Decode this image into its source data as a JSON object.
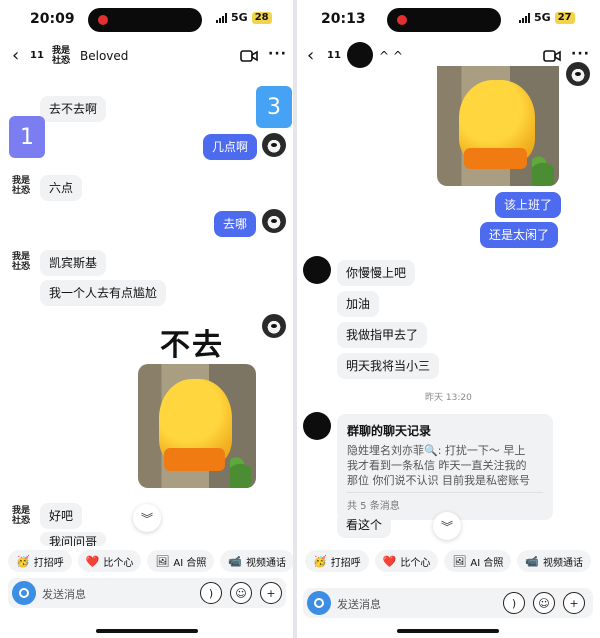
{
  "left": {
    "status": {
      "time": "20:09",
      "network": "5G",
      "battery": "28"
    },
    "header": {
      "back": "‹",
      "unread": "11",
      "nickname": "我是社恐",
      "title": "Beloved",
      "more": "···"
    },
    "messages": {
      "m1": "去不去啊",
      "m2": "几点啊",
      "m3": "六点",
      "m4": "去哪",
      "m5": "凯宾斯基",
      "m6": "我一个人去有点尴尬",
      "m7": "好吧",
      "m8": "我问问哥"
    },
    "nicks": {
      "n1": "我是社恐",
      "n2": "我是社恐",
      "n3": "我是社恐"
    },
    "tiles": {
      "t1": "1",
      "t3": "3"
    },
    "sticker_text": "不去",
    "down": "︾",
    "quick_actions": [
      {
        "icon": "🥳",
        "label": "打招呼"
      },
      {
        "icon": "❤️",
        "label": "比个心"
      },
      {
        "icon": "🖼",
        "label": "AI 合照"
      },
      {
        "icon": "📹",
        "label": "视频通话"
      }
    ],
    "input": {
      "placeholder": "发送消息"
    }
  },
  "right": {
    "status": {
      "time": "20:13",
      "network": "5G",
      "battery": "27"
    },
    "header": {
      "back": "‹",
      "unread": "11",
      "title": "^ ^",
      "more": "···"
    },
    "messages": {
      "r1": "该上班了",
      "r2": "还是太闲了",
      "r3": "你慢慢上吧",
      "r4": "加油",
      "r5": "我做指甲去了",
      "r6": "明天我将当小三",
      "r7": "看这个"
    },
    "time_sep": "昨天 13:20",
    "chat_card": {
      "title": "群聊的聊天记录",
      "body": "隐姓埋名刘亦菲🔍: 打扰一下～ 早上\n我才看到一条私信 昨天一直关注我的\n那位 你们说不认识 目前我是私密账号",
      "footer": "共 5 条消息"
    },
    "down": "︾",
    "quick_actions": [
      {
        "icon": "🥳",
        "label": "打招呼"
      },
      {
        "icon": "❤️",
        "label": "比个心"
      },
      {
        "icon": "🖼",
        "label": "AI 合照"
      },
      {
        "icon": "📹",
        "label": "视频通话"
      }
    ],
    "input": {
      "placeholder": "发送消息"
    }
  }
}
